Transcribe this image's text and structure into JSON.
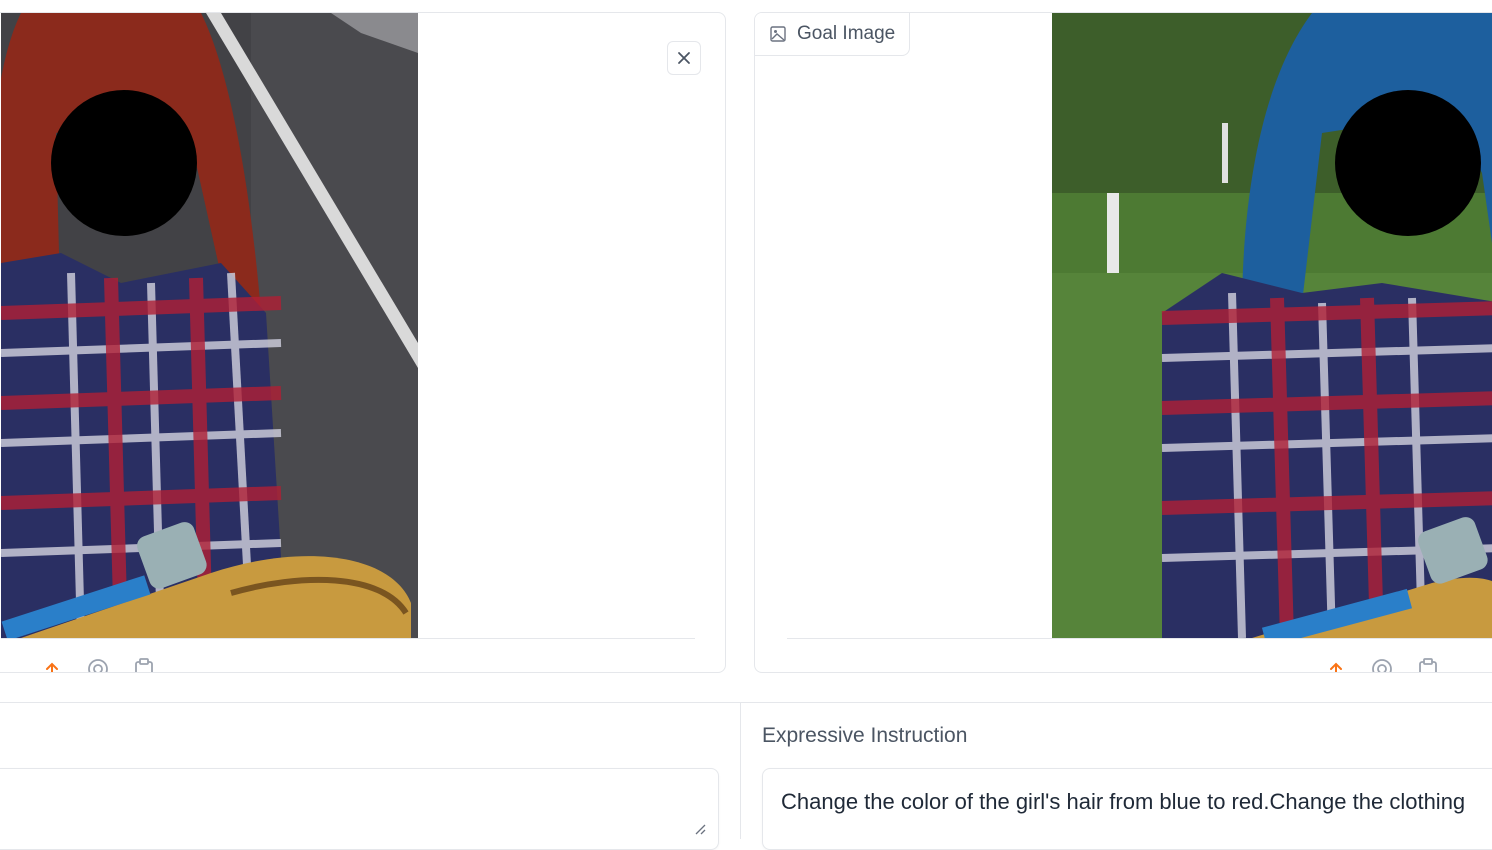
{
  "left_panel": {
    "image_alt": "Input image: person with red hair in plaid shirt holding a skateboard on road",
    "close_label": "×"
  },
  "right_panel": {
    "label": "Goal Image",
    "image_alt": "Goal image: person with blue hair in plaid shirt holding a skateboard on grass"
  },
  "instruction": {
    "label": "Expressive Instruction",
    "value": "Change the color of the girl's hair from blue to red.Change the clothing"
  },
  "colors": {
    "accent": "#f97316",
    "border": "#e5e7eb",
    "text": "#4b5563"
  }
}
